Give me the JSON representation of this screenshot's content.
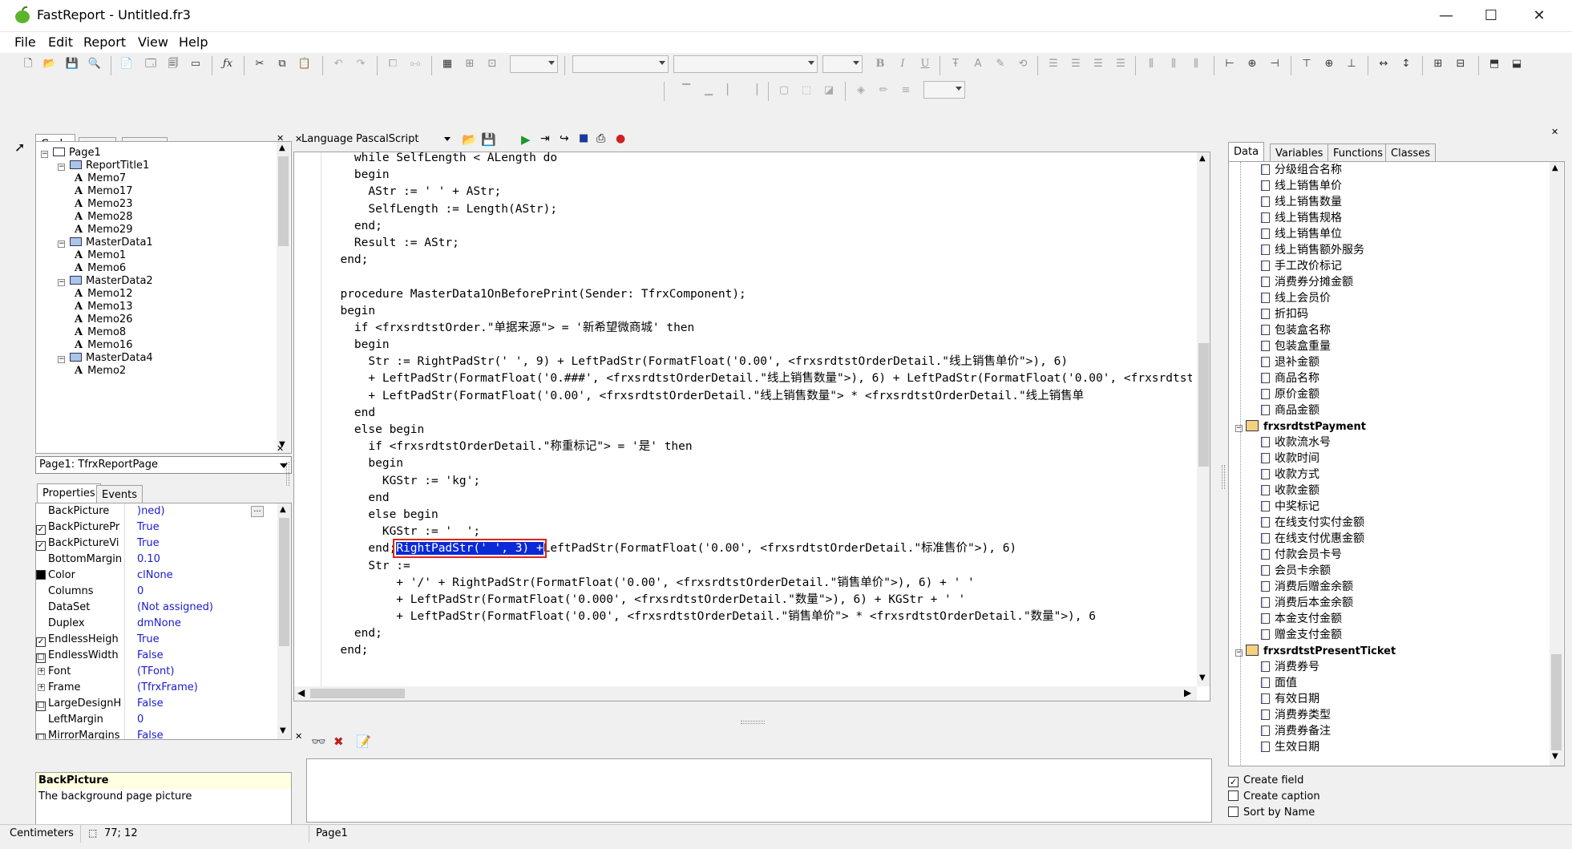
{
  "window": {
    "title": "FastReport - Untitled.fr3",
    "minimize": "—",
    "maximize": "☐",
    "close": "✕"
  },
  "menu": [
    "File",
    "Edit",
    "Report",
    "View",
    "Help"
  ],
  "left_tabs": [
    "Code",
    "Data",
    "Page1"
  ],
  "tree": {
    "items": [
      {
        "label": "Page1",
        "lvl": 0,
        "type": "page"
      },
      {
        "label": "ReportTitle1",
        "lvl": 1,
        "type": "band"
      },
      {
        "label": "Memo7",
        "lvl": 2,
        "type": "memo"
      },
      {
        "label": "Memo17",
        "lvl": 2,
        "type": "memo"
      },
      {
        "label": "Memo23",
        "lvl": 2,
        "type": "memo"
      },
      {
        "label": "Memo28",
        "lvl": 2,
        "type": "memo"
      },
      {
        "label": "Memo29",
        "lvl": 2,
        "type": "memo"
      },
      {
        "label": "MasterData1",
        "lvl": 1,
        "type": "band"
      },
      {
        "label": "Memo1",
        "lvl": 2,
        "type": "memo"
      },
      {
        "label": "Memo6",
        "lvl": 2,
        "type": "memo"
      },
      {
        "label": "MasterData2",
        "lvl": 1,
        "type": "band"
      },
      {
        "label": "Memo12",
        "lvl": 2,
        "type": "memo"
      },
      {
        "label": "Memo13",
        "lvl": 2,
        "type": "memo"
      },
      {
        "label": "Memo26",
        "lvl": 2,
        "type": "memo"
      },
      {
        "label": "Memo8",
        "lvl": 2,
        "type": "memo"
      },
      {
        "label": "Memo16",
        "lvl": 2,
        "type": "memo"
      },
      {
        "label": "MasterData4",
        "lvl": 1,
        "type": "band"
      },
      {
        "label": "Memo2",
        "lvl": 2,
        "type": "memo"
      }
    ]
  },
  "object_selector": "Page1: TfrxReportPage",
  "inspector_tabs": [
    "Properties",
    "Events"
  ],
  "properties": [
    {
      "name": "BackPicture",
      "value": ")ned)",
      "check": "",
      "bold": false
    },
    {
      "name": "BackPicturePr",
      "value": "True",
      "check": "✓",
      "bold": false
    },
    {
      "name": "BackPictureVi",
      "value": "True",
      "check": "✓",
      "bold": false
    },
    {
      "name": "BottomMargin",
      "value": "0.10",
      "check": "",
      "bold": false
    },
    {
      "name": "Color",
      "value": "clNone",
      "check": "■",
      "bold": false
    },
    {
      "name": "Columns",
      "value": "0",
      "check": "",
      "bold": false
    },
    {
      "name": "DataSet",
      "value": "(Not assigned)",
      "check": "",
      "bold": false
    },
    {
      "name": "Duplex",
      "value": "dmNone",
      "check": "",
      "bold": false
    },
    {
      "name": "EndlessHeigh",
      "value": "True",
      "check": "✓",
      "bold": false
    },
    {
      "name": "EndlessWidth",
      "value": "False",
      "check": "☐",
      "bold": false
    },
    {
      "name": "Font",
      "value": "(TFont)",
      "check": "",
      "bold": false
    },
    {
      "name": "Frame",
      "value": "(TfrxFrame)",
      "check": "",
      "bold": false
    },
    {
      "name": "LargeDesignH",
      "value": "False",
      "check": "☐",
      "bold": false
    },
    {
      "name": "LeftMargin",
      "value": "0",
      "check": "",
      "bold": false
    },
    {
      "name": "MirrorMargins",
      "value": "False",
      "check": "☐",
      "bold": false
    },
    {
      "name": "Name",
      "value": "Page1",
      "check": "",
      "bold": true
    }
  ],
  "prop_help": {
    "title": "BackPicture",
    "text": "The background page picture"
  },
  "status": {
    "units": "Centimeters",
    "coords": "77; 12",
    "page": "Page1"
  },
  "code": {
    "language_label": "Language:",
    "language": "PascalScript",
    "lines": [
      "    while SelfLength < ALength do",
      "    begin",
      "      AStr := ' ' + AStr;",
      "      SelfLength := Length(AStr);",
      "    end;",
      "    Result := AStr;",
      "  end;",
      "",
      "  procedure MasterData1OnBeforePrint(Sender: TfrxComponent);",
      "  begin",
      "    if <frxsrdtstOrder.\"单据来源\"> = '新希望微商城' then",
      "    begin",
      "      Str := RightPadStr(' ', 9) + LeftPadStr(FormatFloat('0.00', <frxsrdtstOrderDetail.\"线上销售单价\">), 6)",
      "      + LeftPadStr(FormatFloat('0.###', <frxsrdtstOrderDetail.\"线上销售数量\">), 6) + LeftPadStr(FormatFloat('0.00', <frxsrdtstOrderDetail.\"线上",
      "      + LeftPadStr(FormatFloat('0.00', <frxsrdtstOrderDetail.\"线上销售数量\"> * <frxsrdtstOrderDetail.\"线上销售单",
      "    end",
      "    else begin",
      "      if <frxsrdtstOrderDetail.\"称重标记\"> = '是' then",
      "      begin",
      "        KGStr := 'kg';",
      "      end",
      "      else begin",
      "        KGStr := '  ';",
      "      end;",
      "      Str := ",
      "          + '/' + RightPadStr(FormatFloat('0.00', <frxsrdtstOrderDetail.\"销售单价\">), 6) + ' '",
      "          + LeftPadStr(FormatFloat('0.000', <frxsrdtstOrderDetail.\"数量\">), 6) + KGStr + ' '",
      "          + LeftPadStr(FormatFloat('0.00', <frxsrdtstOrderDetail.\"销售单价\"> * <frxsrdtstOrderDetail.\"数量\">), 6",
      "    end;",
      "  end;"
    ],
    "highlighted": "RightPadStr(' ', 3) +",
    "after_highlight": "LeftPadStr(FormatFloat('0.00', <frxsrdtstOrderDetail.\"标准售价\">), 6)"
  },
  "dict_tabs": [
    "Data",
    "Variables",
    "Functions",
    "Classes"
  ],
  "dict": {
    "items": [
      {
        "label": "分级组合名称",
        "type": "field"
      },
      {
        "label": "线上销售单价",
        "type": "field"
      },
      {
        "label": "线上销售数量",
        "type": "field"
      },
      {
        "label": "线上销售规格",
        "type": "field"
      },
      {
        "label": "线上销售单位",
        "type": "field"
      },
      {
        "label": "线上销售额外服务",
        "type": "field"
      },
      {
        "label": "手工改价标记",
        "type": "field"
      },
      {
        "label": "消费券分摊金额",
        "type": "field"
      },
      {
        "label": "线上会员价",
        "type": "field"
      },
      {
        "label": "折扣码",
        "type": "field"
      },
      {
        "label": "包装盒名称",
        "type": "field"
      },
      {
        "label": "包装盒重量",
        "type": "field"
      },
      {
        "label": "退补金额",
        "type": "field"
      },
      {
        "label": "商品名称",
        "type": "field"
      },
      {
        "label": "原价金额",
        "type": "field"
      },
      {
        "label": "商品金额",
        "type": "field"
      },
      {
        "label": "frxsrdtstPayment",
        "type": "dataset"
      },
      {
        "label": "收款流水号",
        "type": "field"
      },
      {
        "label": "收款时间",
        "type": "field"
      },
      {
        "label": "收款方式",
        "type": "field"
      },
      {
        "label": "收款金额",
        "type": "field"
      },
      {
        "label": "中奖标记",
        "type": "field"
      },
      {
        "label": "在线支付实付金额",
        "type": "field"
      },
      {
        "label": "在线支付优惠金额",
        "type": "field"
      },
      {
        "label": "付款会员卡号",
        "type": "field"
      },
      {
        "label": "会员卡余额",
        "type": "field"
      },
      {
        "label": "消费后赠金余额",
        "type": "field"
      },
      {
        "label": "消费后本金余额",
        "type": "field"
      },
      {
        "label": "本金支付金额",
        "type": "field"
      },
      {
        "label": "赠金支付金额",
        "type": "field"
      },
      {
        "label": "frxsrdtstPresentTicket",
        "type": "dataset"
      },
      {
        "label": "消费券号",
        "type": "field"
      },
      {
        "label": "面值",
        "type": "field"
      },
      {
        "label": "有效日期",
        "type": "field"
      },
      {
        "label": "消费券类型",
        "type": "field"
      },
      {
        "label": "消费券备注",
        "type": "field"
      },
      {
        "label": "生效日期",
        "type": "field"
      }
    ]
  },
  "dict_options": [
    {
      "label": "Create field",
      "checked": "✓"
    },
    {
      "label": "Create caption",
      "checked": ""
    },
    {
      "label": "Sort by Name",
      "checked": ""
    }
  ],
  "colors": {
    "highlight_bg": "#0a2ad8",
    "highlight_border": "#e0231c",
    "app_bg": "#f0f0f0"
  }
}
